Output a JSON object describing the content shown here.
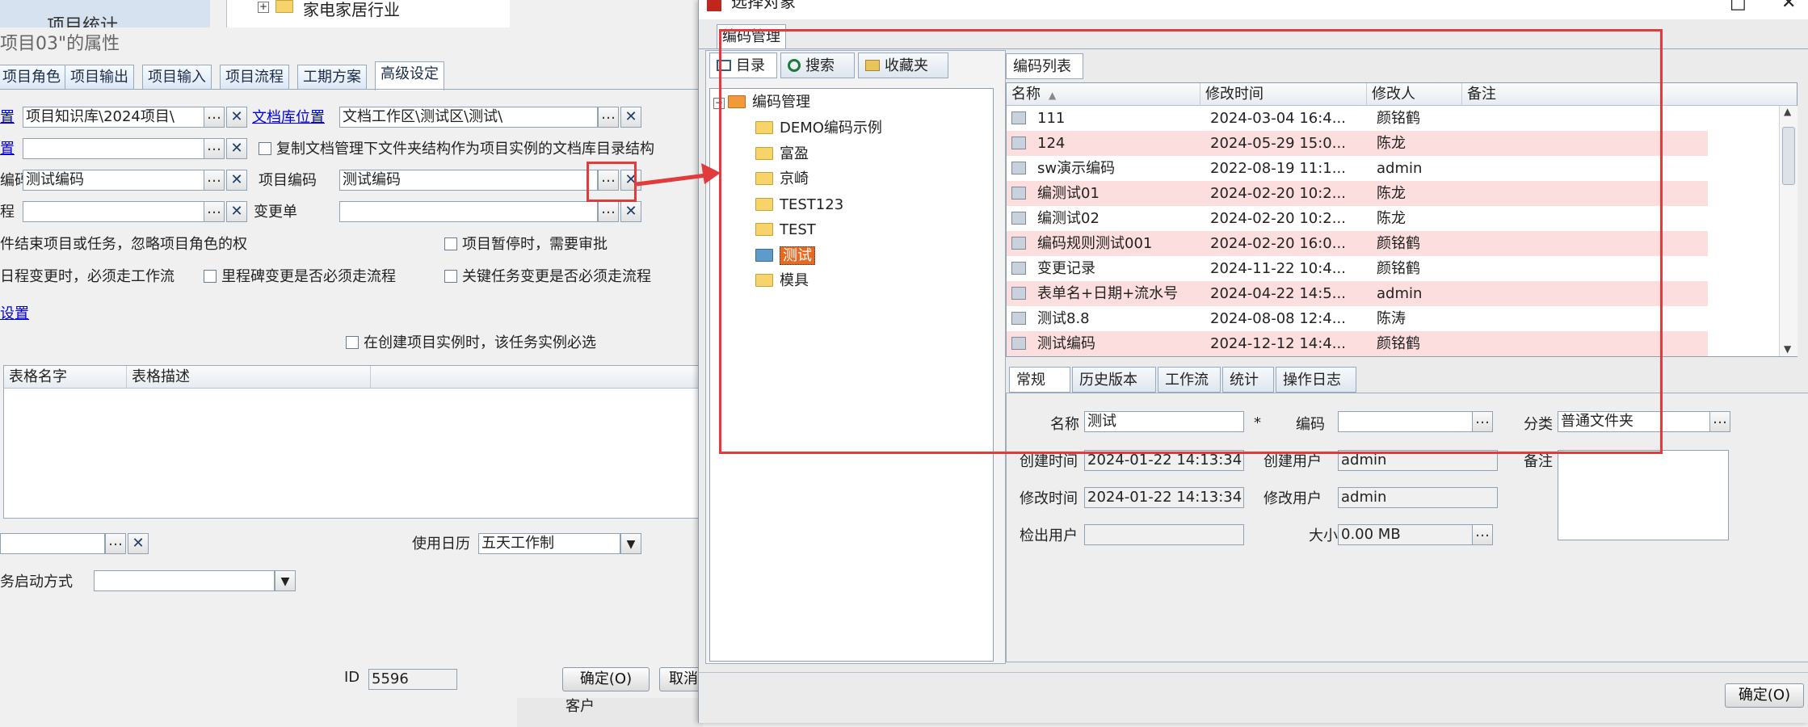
{
  "background": {
    "top_left_text": "项目统计",
    "tree_item": "家电家居行业",
    "bottom_customer_label": "客户"
  },
  "prop_dialog": {
    "title": "项目03\"的属性",
    "tabs": [
      "项目角色",
      "项目输出",
      "项目输入",
      "项目流程",
      "工期方案",
      "高级设定"
    ],
    "active_tab": "高级设定",
    "row1": {
      "label": "置",
      "value": "项目知识库\\2024项目\\",
      "link_label": "文档库位置",
      "link_value": "文档工作区\\测试区\\测试\\"
    },
    "row2": {
      "label": "置",
      "value": "",
      "checkbox_label": "复制文档管理下文件夹结构作为项目实例的文档库目录结构"
    },
    "row3": {
      "label": "编码",
      "value": "测试编码",
      "right_label": "项目编码",
      "right_value": "测试编码"
    },
    "row4": {
      "label": "程",
      "value": "",
      "right_label": "变更单",
      "right_value": ""
    },
    "opt1": "件结束项目或任务，忽略项目角色的权",
    "opt2": "项目暂停时，需要审批",
    "opt3": "日程变更时，必须走工作流",
    "opt4": "里程碑变更是否必须走流程",
    "opt5": "关键任务变更是否必须走流程",
    "settings_link": "设置",
    "opt6": "在创建项目实例时，该任务实例必选",
    "grid_headers": [
      "表格名字",
      "表格描述"
    ],
    "calendar_label": "使用日历",
    "calendar_value": "五天工作制",
    "startup_label": "务启动方式",
    "id_label": "ID",
    "id_value": "5596",
    "ok_button": "确定(O)",
    "cancel_button": "取消"
  },
  "sel_dialog": {
    "title": "选择对象",
    "mgr_tab": "编码管理",
    "left_tabs": [
      "目录",
      "搜索",
      "收藏夹"
    ],
    "tree_root": "编码管理",
    "tree_items": [
      "DEMO编码示例",
      "富盈",
      "京崎",
      "TEST123",
      "TEST",
      "测试",
      "模具"
    ],
    "selected_item": "测试",
    "list_tab": "编码列表",
    "columns": [
      "名称",
      "修改时间",
      "修改人",
      "备注"
    ],
    "rows": [
      {
        "name": "111",
        "time": "2024-03-04 16:4...",
        "user": "颜铭鹤"
      },
      {
        "name": "124",
        "time": "2024-05-29 15:0...",
        "user": "陈龙"
      },
      {
        "name": "sw演示编码",
        "time": "2022-08-19 11:1...",
        "user": "admin"
      },
      {
        "name": "编测试01",
        "time": "2024-02-20 10:2...",
        "user": "陈龙"
      },
      {
        "name": "编测试02",
        "time": "2024-02-20 10:2...",
        "user": "陈龙"
      },
      {
        "name": "编码规则测试001",
        "time": "2024-02-20 16:0...",
        "user": "颜铭鹤"
      },
      {
        "name": "变更记录",
        "time": "2024-11-22 10:4...",
        "user": "颜铭鹤"
      },
      {
        "name": "表单名+日期+流水号",
        "time": "2024-04-22 14:5...",
        "user": "admin"
      },
      {
        "name": "测试8.8",
        "time": "2024-08-08 12:4...",
        "user": "陈涛"
      },
      {
        "name": "测试编码",
        "time": "2024-12-12 14:4...",
        "user": "颜铭鹤"
      }
    ],
    "detail_tabs": [
      "常规",
      "历史版本",
      "工作流",
      "统计",
      "操作日志"
    ],
    "detail": {
      "name_label": "名称",
      "name_value": "测试",
      "required": "*",
      "code_label": "编码",
      "code_value": "",
      "category_label": "分类",
      "category_value": "普通文件夹",
      "created_time_label": "创建时间",
      "created_time_value": "2024-01-22 14:13:34",
      "created_user_label": "创建用户",
      "created_user_value": "admin",
      "note_label": "备注",
      "modified_time_label": "修改时间",
      "modified_time_value": "2024-01-22 14:13:34",
      "modified_user_label": "修改用户",
      "modified_user_value": "admin",
      "checkout_label": "检出用户",
      "checkout_value": "",
      "size_label": "大小",
      "size_value": "0.00 MB"
    },
    "ok_button": "确定(O)"
  },
  "colors": {
    "annotation_red": "#e23b3b",
    "alt_row": "#fcdede",
    "tree_selected": "#e86a20"
  }
}
